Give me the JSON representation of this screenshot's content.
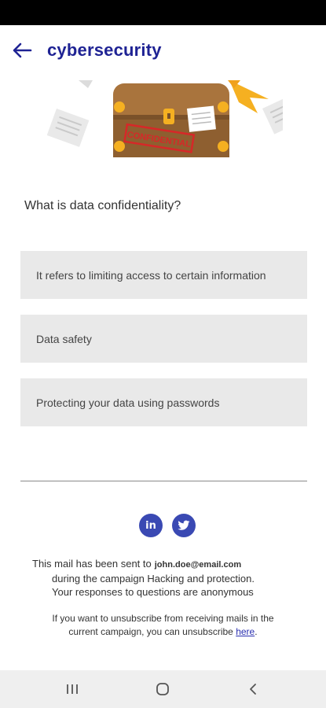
{
  "app_bar": {
    "title": "cybersecurity",
    "back_icon": "arrow-left-icon"
  },
  "hero": {
    "stamp_text": "CONFIDENTIAL"
  },
  "quiz": {
    "question": "What is data confidentiality?",
    "answers": [
      "It refers to limiting access to certain information",
      "Data safety",
      "Protecting your data using passwords"
    ]
  },
  "social": {
    "linkedin_label": "in",
    "twitter_icon": "twitter-icon"
  },
  "footer": {
    "mail_prefix": "This mail has been sent to",
    "email": "john.doe@email.com",
    "campaign_line": "during the campaign Hacking and protection.",
    "anonymous_line": "Your responses to questions are anonymous",
    "unsub_line1": "If you want to unsubscribe from receiving mails in the",
    "unsub_line2": "current campaign, you can unsubscribe",
    "unsub_link": "here",
    "unsub_end": "."
  },
  "colors": {
    "accent": "#1f2394",
    "social": "#3a49b3",
    "answer_bg": "#e9e9e9",
    "stamp": "#d62828",
    "chest": "#a9743d",
    "gold": "#f5b021"
  }
}
